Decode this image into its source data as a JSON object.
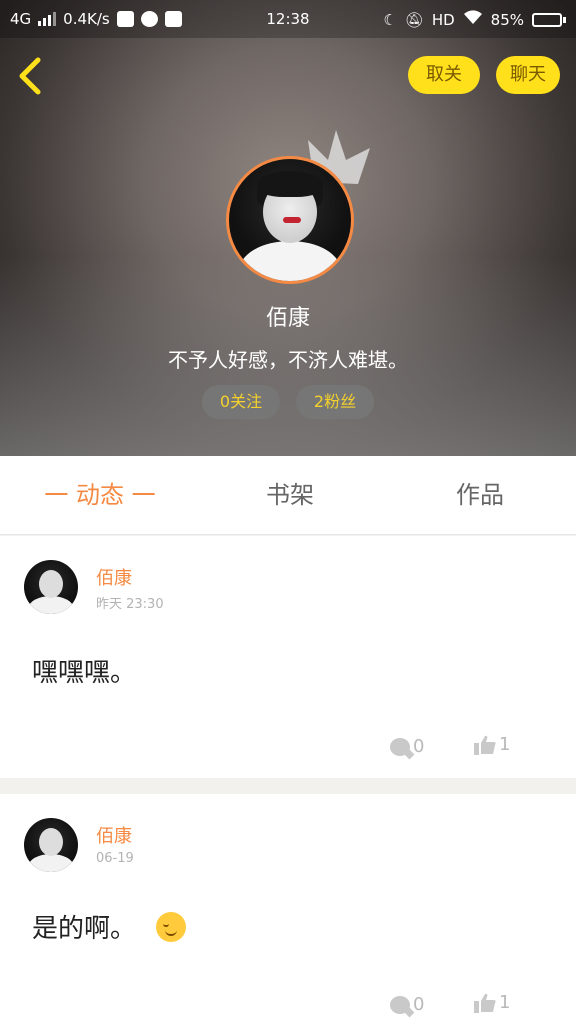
{
  "status_bar": {
    "network": "4G",
    "speed": "0.4K/s",
    "time": "12:38",
    "hd": "HD",
    "battery_percent": "85%",
    "battery_level": 0.85
  },
  "header": {
    "unfollow_label": "取关",
    "chat_label": "聊天",
    "name": "佰康",
    "bio": "不予人好感，不济人难堪。",
    "following_label": "0关注",
    "followers_label": "2粉丝"
  },
  "tabs": {
    "feed": "一 动态 一",
    "bookshelf": "书架",
    "works": "作品"
  },
  "posts": [
    {
      "author": "佰康",
      "time": "昨天 23:30",
      "text": "嘿嘿嘿。",
      "comments": "0",
      "likes": "1"
    },
    {
      "author": "佰康",
      "time": "06-19",
      "text": "是的啊。",
      "comments": "0",
      "likes": "1"
    }
  ],
  "colors": {
    "accent": "#f48a43",
    "pill_yellow": "#ffe01a",
    "stat_text": "#f4d22b"
  },
  "icons": [
    "back-icon",
    "crown-icon",
    "comment-icon",
    "like-icon",
    "smile-emoji-icon"
  ]
}
